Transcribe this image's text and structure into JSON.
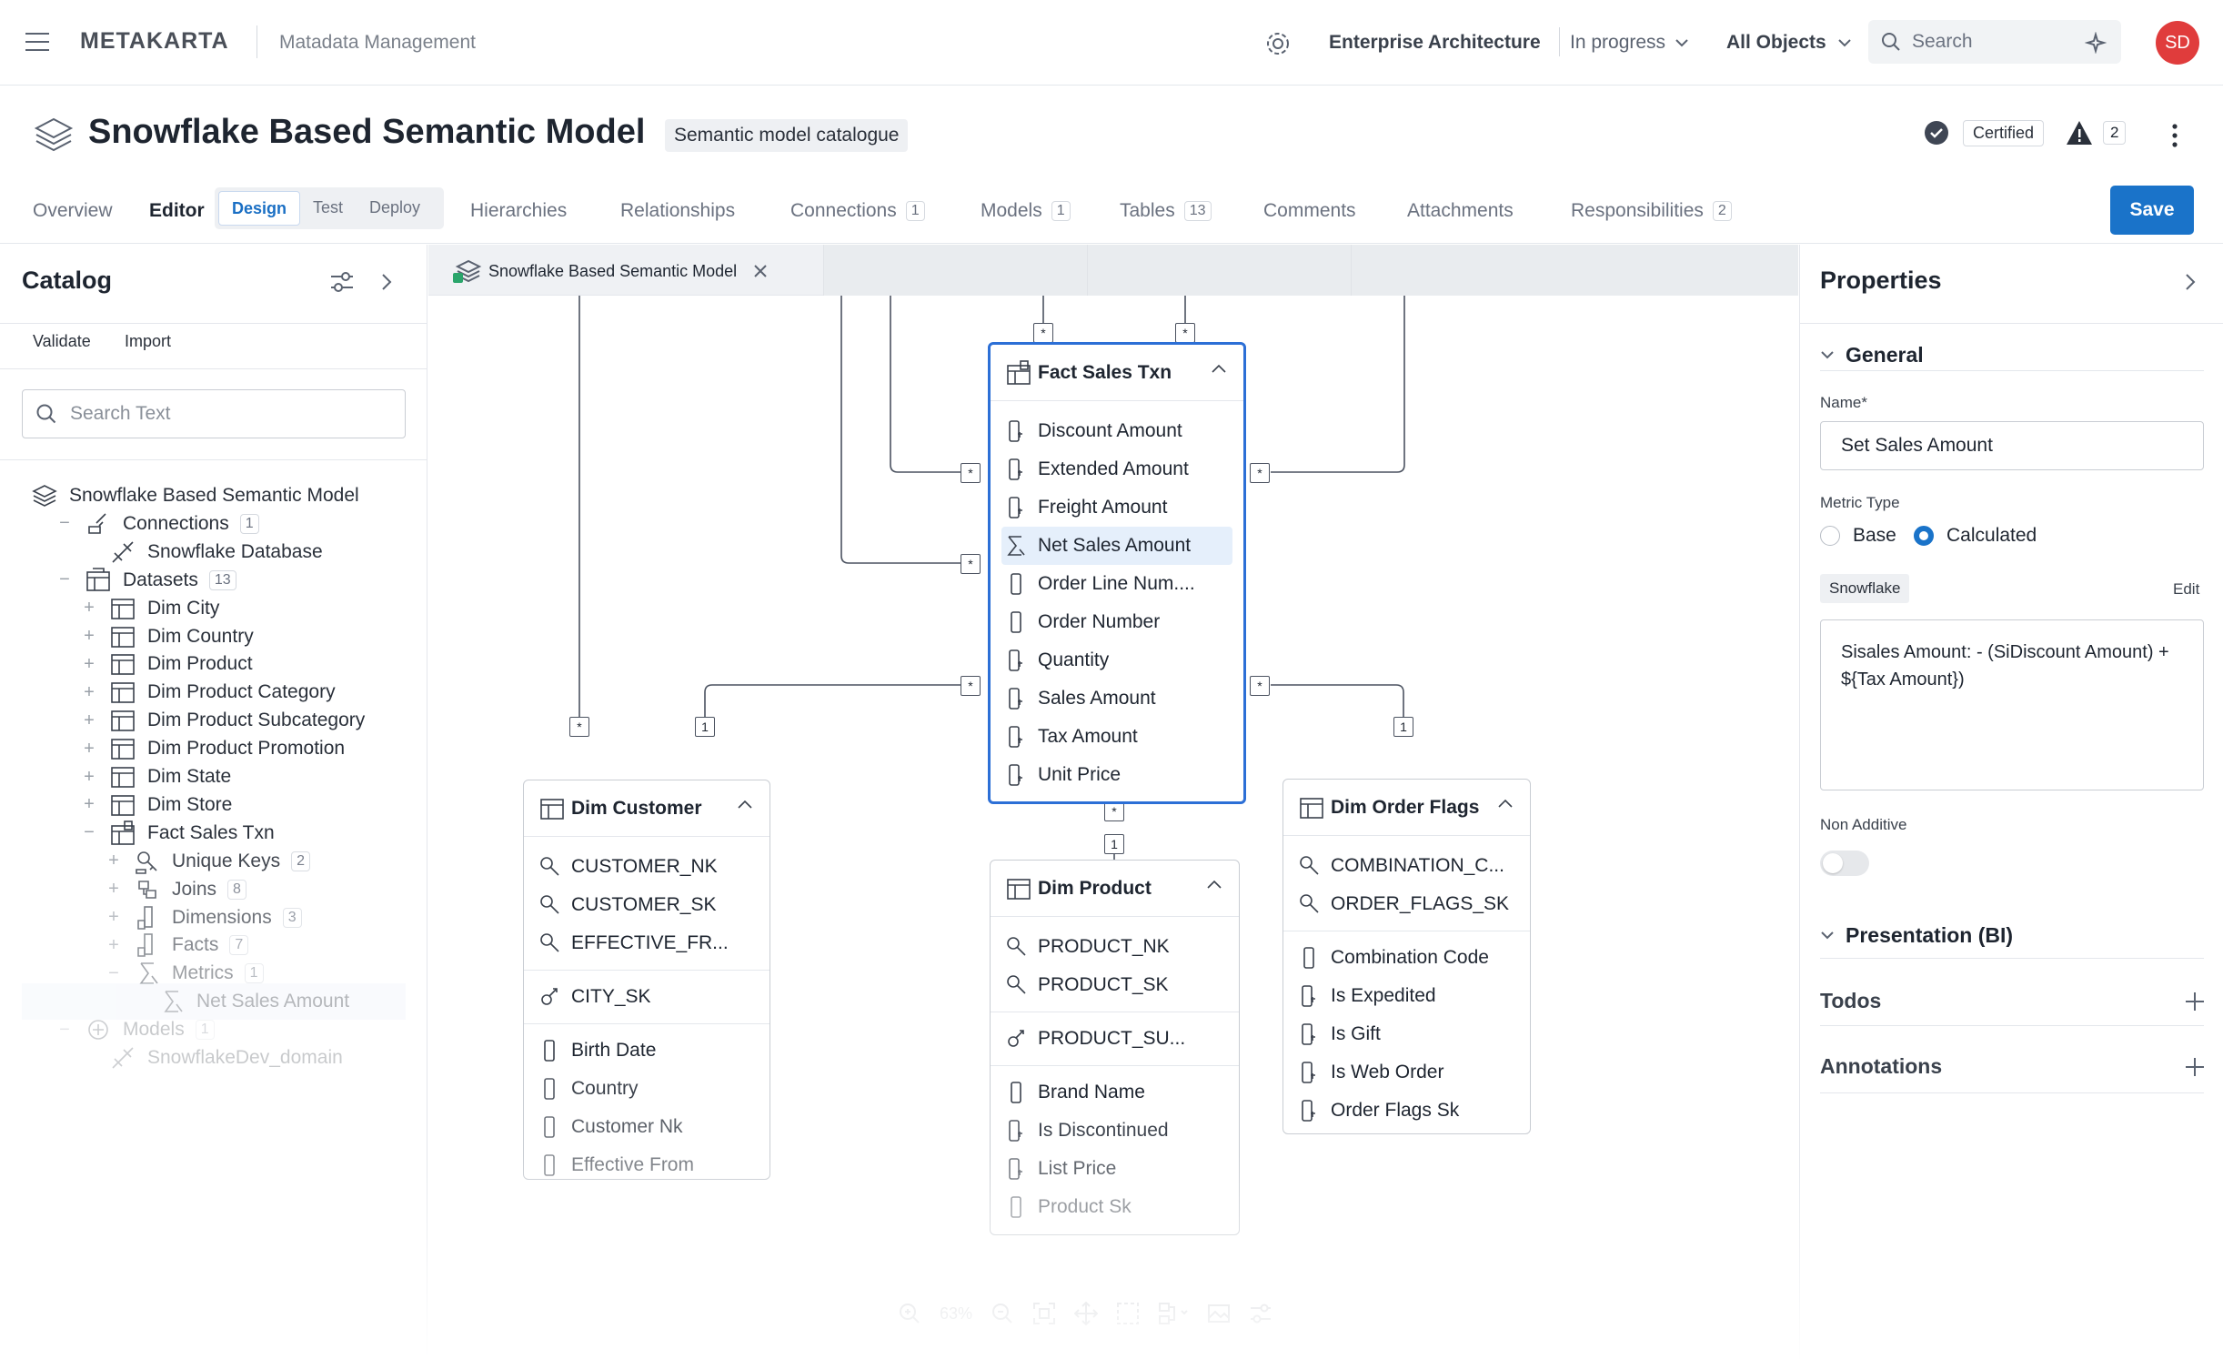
{
  "topbar": {
    "logo": "METAKARTA",
    "app_name": "Matadata Management",
    "workspace": "Enterprise Architecture",
    "status": "In progress",
    "scope": "All Objects",
    "search_placeholder": "Search",
    "avatar_initials": "SD",
    "avatar_color": "#e03c3c"
  },
  "title": {
    "name": "Snowflake Based Semantic Model",
    "badge": "Semantic model catalogue",
    "certified": "Certified",
    "warnings": "2"
  },
  "tabs": {
    "overview": "Overview",
    "editor": "Editor",
    "design": "Design",
    "test": "Test",
    "deploy": "Deploy",
    "hierarchies": "Hierarchies",
    "relationships": "Relationships",
    "connections": "Connections",
    "connections_count": "1",
    "models": "Models",
    "models_count": "1",
    "tables": "Tables",
    "tables_count": "13",
    "comments": "Comments",
    "attachments": "Attachments",
    "responsibilities": "Responsibilities",
    "responsibilities_count": "2",
    "save": "Save",
    "accent": "#1a73c9"
  },
  "catalog": {
    "title": "Catalog",
    "validate": "Validate",
    "import": "Import",
    "search_placeholder": "Search Text",
    "tree": [
      {
        "label": "Snowflake Based Semantic Model",
        "count": ""
      },
      {
        "label": "Connections",
        "count": "1"
      },
      {
        "label": "Snowflake Database",
        "count": ""
      },
      {
        "label": "Datasets",
        "count": "13"
      },
      {
        "label": "Dim City",
        "count": ""
      },
      {
        "label": "Dim Country",
        "count": ""
      },
      {
        "label": "Dim Product",
        "count": ""
      },
      {
        "label": "Dim Product Category",
        "count": ""
      },
      {
        "label": "Dim Product Subcategory",
        "count": ""
      },
      {
        "label": "Dim Product Promotion",
        "count": ""
      },
      {
        "label": "Dim State",
        "count": ""
      },
      {
        "label": "Dim Store",
        "count": ""
      },
      {
        "label": "Fact Sales Txn",
        "count": ""
      },
      {
        "label": "Unique Keys",
        "count": "2"
      },
      {
        "label": "Joins",
        "count": "8"
      },
      {
        "label": "Dimensions",
        "count": "3"
      },
      {
        "label": "Facts",
        "count": "7"
      },
      {
        "label": "Metrics",
        "count": "1"
      },
      {
        "label": "Net Sales Amount",
        "count": ""
      },
      {
        "label": "Models",
        "count": "1"
      },
      {
        "label": "SnowflakeDev_domain",
        "count": ""
      }
    ]
  },
  "canvas": {
    "tab_label": "Snowflake Based Semantic Model",
    "zoom": "63%",
    "fact": {
      "title": "Fact Sales Txn",
      "fields": [
        "Discount Amount",
        "Extended Amount",
        "Freight Amount",
        "Net Sales Amount",
        "Order Line Num....",
        "Order Number",
        "Quantity",
        "Sales Amount",
        "Tax Amount",
        "Unit Price"
      ]
    },
    "customer": {
      "title": "Dim Customer",
      "keys": [
        "CUSTOMER_NK",
        "CUSTOMER_SK",
        "EFFECTIVE_FR..."
      ],
      "fks": [
        "CITY_SK"
      ],
      "fields": [
        "Birth Date",
        "Country",
        "Customer Nk",
        "Effective From"
      ]
    },
    "product": {
      "title": "Dim Product",
      "keys": [
        "PRODUCT_NK",
        "PRODUCT_SK"
      ],
      "fks": [
        "PRODUCT_SU..."
      ],
      "fields": [
        "Brand Name",
        "Is Discontinued",
        "List Price",
        "Product Sk"
      ]
    },
    "flags": {
      "title": "Dim Order Flags",
      "keys": [
        "COMBINATION_C...",
        "ORDER_FLAGS_SK"
      ],
      "fields": [
        "Combination Code",
        "Is Expedited",
        "Is Gift",
        "Is Web Order",
        "Order Flags Sk"
      ]
    },
    "marks": {
      "many": "*",
      "one": "1"
    }
  },
  "properties": {
    "title": "Properties",
    "general": "General",
    "name_label": "Name*",
    "name_value": "Set Sales Amount",
    "metric_type_label": "Metric Type",
    "base": "Base",
    "calculated": "Calculated",
    "dialect": "Snowflake",
    "edit": "Edit",
    "expression": "Sisales Amount: - (SiDiscount Amount) + ${Tax Amount})",
    "non_additive": "Non Additive",
    "presentation": "Presentation (BI)",
    "todos": "Todos",
    "annotations": "Annotations"
  }
}
